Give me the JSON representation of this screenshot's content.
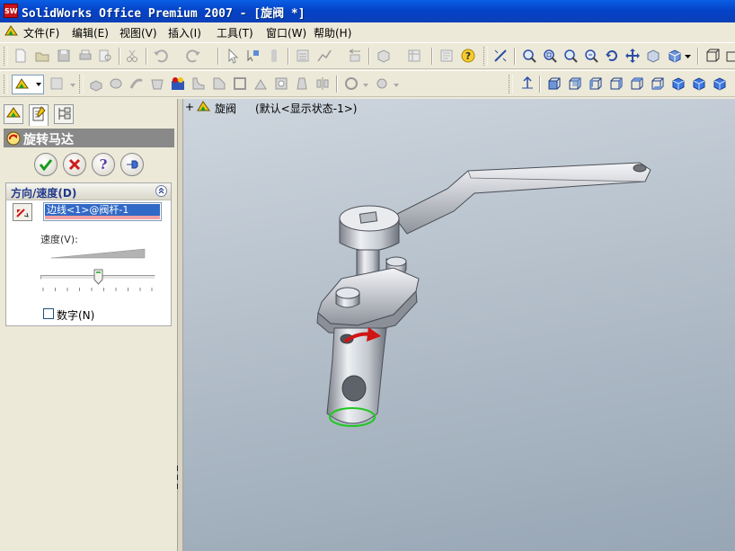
{
  "window": {
    "title": "SolidWorks Office Premium 2007 - [旋阀 *]",
    "app_icon_text": "SW"
  },
  "menu": {
    "items": [
      "文件(F)",
      "编辑(E)",
      "视图(V)",
      "插入(I)",
      "工具(T)",
      "窗口(W)",
      "帮助(H)"
    ]
  },
  "tree": {
    "expander": "+",
    "part_name": "旋阀",
    "config": "(默认<显示状态-1>)"
  },
  "property_manager": {
    "title": "旋转马达",
    "tabs": [
      "feature-manager",
      "property-manager",
      "configuration-manager"
    ],
    "active_tab": "property-manager",
    "buttons": [
      "ok",
      "cancel",
      "help",
      "pin"
    ],
    "direction_group": {
      "label": "方向/速度(D)",
      "selection": "边线<1>@阀杆-1"
    },
    "speed": {
      "label": "速度(V):",
      "value_fraction": 0.5
    },
    "numeric": {
      "label": "数字(N)",
      "checked": false
    }
  },
  "colors": {
    "title_bar": "#0a5fe4",
    "selection_highlight": "#3169c6",
    "motor_arrow": "#d01414",
    "edge_selection": "#1ec81e"
  }
}
